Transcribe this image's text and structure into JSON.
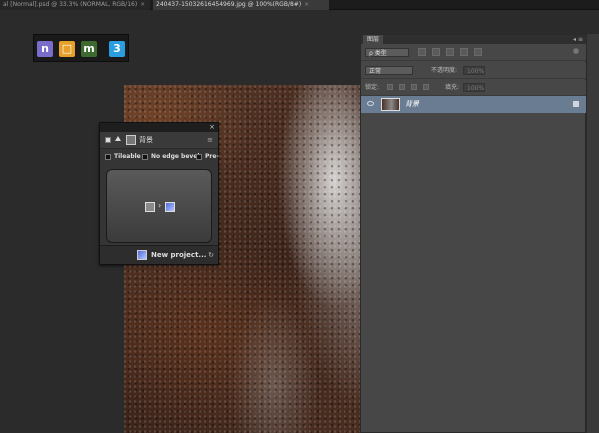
{
  "tabs": [
    {
      "label": "al [Normal].psd @ 33.3% (NORMAL, RGB/16)",
      "active": false
    },
    {
      "label": "240437-15032616454969.jpg @ 100%(RGB/8#)",
      "active": true
    }
  ],
  "toolbox": {
    "icons": [
      {
        "name": "n-icon",
        "glyph": "n",
        "color": "#7a6cc9"
      },
      {
        "name": "square-icon",
        "glyph": "□",
        "color": "#e6a12a"
      },
      {
        "name": "m-icon",
        "glyph": "m",
        "color": "#3e6a32"
      },
      {
        "name": "three-icon",
        "glyph": "3",
        "color": "#2a9ee0"
      }
    ]
  },
  "layers_panel": {
    "tab_label": "图层",
    "menu_glyph": "◂ ≡",
    "filter_kind": "ρ 类型",
    "blend_mode": "正常",
    "opacity_label": "不透明度:",
    "opacity_value": "100%",
    "lock_label": "锁定:",
    "fill_label": "填充:",
    "fill_value": "100%",
    "layer_name": "背景"
  },
  "plugin_panel": {
    "title": "背景",
    "tileable_label": "Tileable",
    "no_edge_bevel_label": "No edge bevel",
    "pre_label": "Pre-",
    "new_project_label": "New project..."
  }
}
